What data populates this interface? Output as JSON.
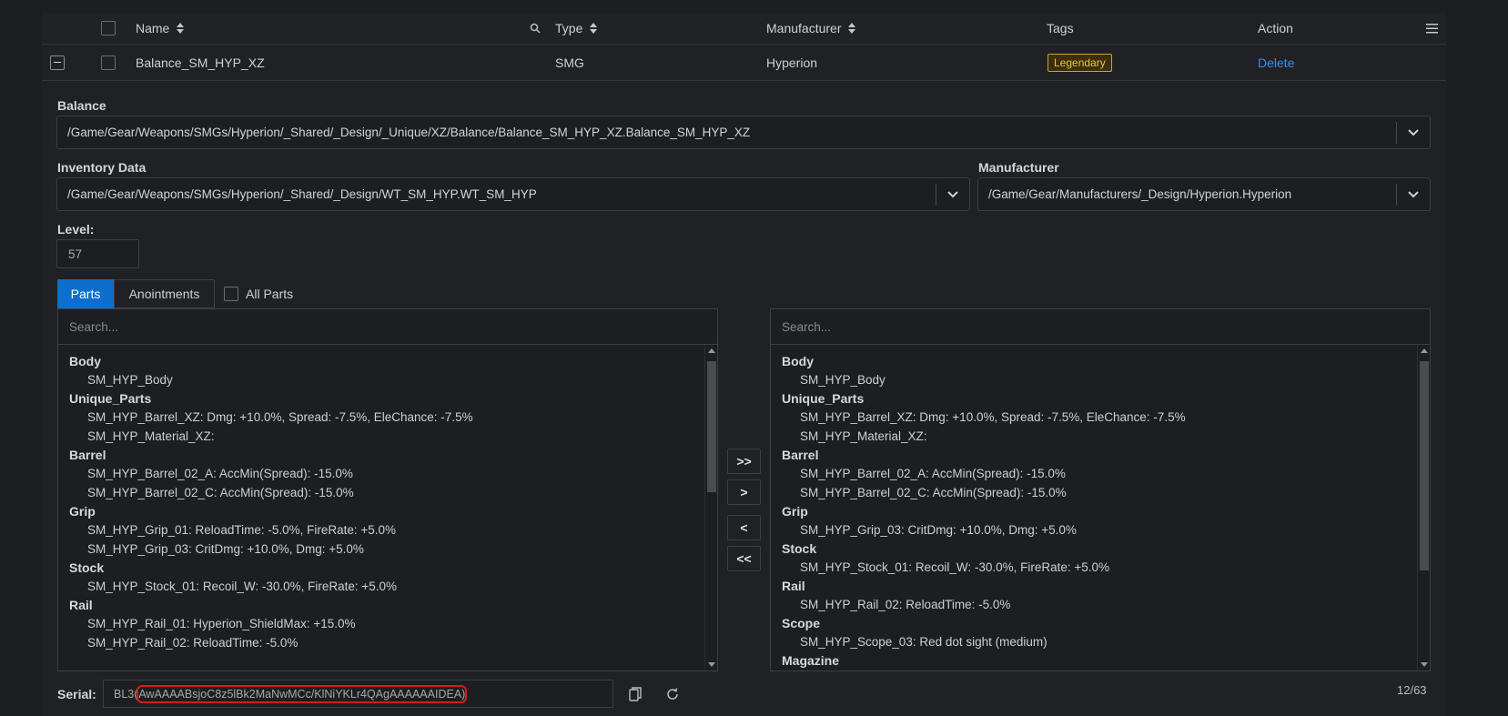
{
  "table": {
    "headers": {
      "name": "Name",
      "type": "Type",
      "manufacturer": "Manufacturer",
      "tags": "Tags",
      "action": "Action"
    },
    "row": {
      "name": "Balance_SM_HYP_XZ",
      "type": "SMG",
      "manufacturer": "Hyperion",
      "tag": "Legendary",
      "action": "Delete"
    }
  },
  "form": {
    "balance_label": "Balance",
    "balance_value": "/Game/Gear/Weapons/SMGs/Hyperion/_Shared/_Design/_Unique/XZ/Balance/Balance_SM_HYP_XZ.Balance_SM_HYP_XZ",
    "inventory_label": "Inventory Data",
    "inventory_value": "/Game/Gear/Weapons/SMGs/Hyperion/_Shared/_Design/WT_SM_HYP.WT_SM_HYP",
    "manufacturer_label": "Manufacturer",
    "manufacturer_value": "/Game/Gear/Manufacturers/_Design/Hyperion.Hyperion",
    "level_label": "Level:",
    "level_value": "57"
  },
  "tabs": {
    "parts": "Parts",
    "anointments": "Anointments",
    "all_parts": "All Parts"
  },
  "left_list": {
    "search_placeholder": "Search...",
    "groups": [
      {
        "name": "Body",
        "items": [
          "SM_HYP_Body"
        ]
      },
      {
        "name": "Unique_Parts",
        "items": [
          "SM_HYP_Barrel_XZ: Dmg: +10.0%, Spread: -7.5%, EleChance: -7.5%",
          "SM_HYP_Material_XZ:"
        ]
      },
      {
        "name": "Barrel",
        "items": [
          "SM_HYP_Barrel_02_A: AccMin(Spread): -15.0%",
          "SM_HYP_Barrel_02_C: AccMin(Spread): -15.0%"
        ]
      },
      {
        "name": "Grip",
        "items": [
          "SM_HYP_Grip_01: ReloadTime: -5.0%, FireRate: +5.0%",
          "SM_HYP_Grip_03: CritDmg: +10.0%, Dmg: +5.0%"
        ]
      },
      {
        "name": "Stock",
        "items": [
          "SM_HYP_Stock_01: Recoil_W: -30.0%, FireRate: +5.0%"
        ]
      },
      {
        "name": "Rail",
        "items": [
          "SM_HYP_Rail_01: Hyperion_ShieldMax: +15.0%",
          "SM_HYP_Rail_02: ReloadTime: -5.0%"
        ]
      }
    ]
  },
  "right_list": {
    "search_placeholder": "Search...",
    "groups": [
      {
        "name": "Body",
        "items": [
          "SM_HYP_Body"
        ]
      },
      {
        "name": "Unique_Parts",
        "items": [
          "SM_HYP_Barrel_XZ: Dmg: +10.0%, Spread: -7.5%, EleChance: -7.5%",
          "SM_HYP_Material_XZ:"
        ]
      },
      {
        "name": "Barrel",
        "items": [
          "SM_HYP_Barrel_02_A: AccMin(Spread): -15.0%",
          "SM_HYP_Barrel_02_C: AccMin(Spread): -15.0%"
        ]
      },
      {
        "name": "Grip",
        "items": [
          "SM_HYP_Grip_03: CritDmg: +10.0%, Dmg: +5.0%"
        ]
      },
      {
        "name": "Stock",
        "items": [
          "SM_HYP_Stock_01: Recoil_W: -30.0%, FireRate: +5.0%"
        ]
      },
      {
        "name": "Rail",
        "items": [
          "SM_HYP_Rail_02: ReloadTime: -5.0%"
        ]
      },
      {
        "name": "Scope",
        "items": [
          "SM_HYP_Scope_03: Red dot sight (medium)"
        ]
      },
      {
        "name": "Magazine",
        "items": []
      }
    ]
  },
  "move_buttons": {
    "add_all": ">>",
    "add": ">",
    "remove": "<",
    "remove_all": "<<"
  },
  "serial": {
    "label": "Serial:",
    "prefix": "BL3(",
    "value": "AwAAAABsjoC8z5lBk2MaNwMCc/KlNiYKLr4QAgAAAAAAIDEA)"
  },
  "count": "12/63",
  "icons": [
    "search-icon",
    "menu-icon",
    "chevron-down-icon",
    "copy-icon",
    "refresh-icon"
  ],
  "colors": {
    "accent": "#0d6ecd",
    "link": "#3b8ee6",
    "legendary": "#e8c24a",
    "highlight": "#d91a1a"
  }
}
